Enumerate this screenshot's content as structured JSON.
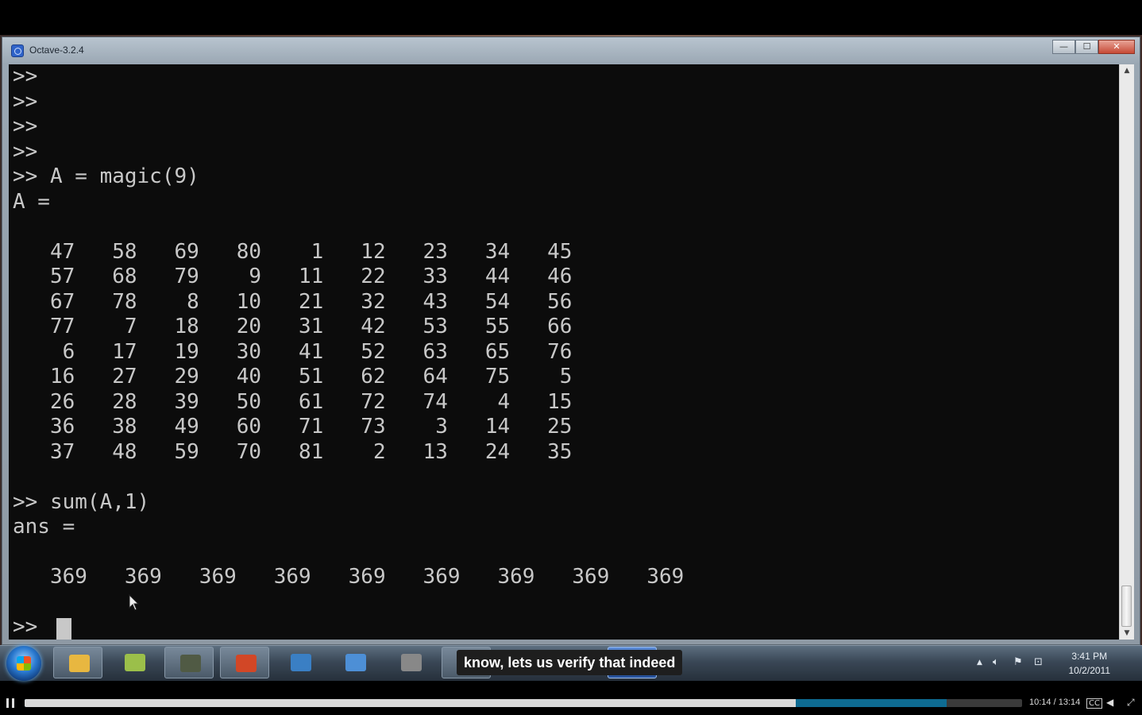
{
  "window": {
    "title": "Octave-3.2.4",
    "controls": {
      "minimize": "—",
      "maximize": "☐",
      "close": "✕"
    }
  },
  "console": {
    "lines": [
      ">>",
      ">>",
      ">>",
      ">>",
      ">> A = magic(9)",
      "A =",
      "",
      "   47   58   69   80    1   12   23   34   45",
      "   57   68   79    9   11   22   33   44   46",
      "   67   78    8   10   21   32   43   54   56",
      "   77    7   18   20   31   42   53   55   66",
      "    6   17   19   30   41   52   63   65   76",
      "   16   27   29   40   51   62   64   75    5",
      "   26   28   39   50   61   72   74    4   15",
      "   36   38   49   60   71   73    3   14   25",
      "   37   48   59   70   81    2   13   24   35",
      "",
      ">> sum(A,1)",
      "ans =",
      "",
      "   369   369   369   369   369   369   369   369   369",
      "",
      ">>"
    ]
  },
  "taskbar": {
    "pinned": [
      {
        "name": "explorer-icon",
        "color": "#e8b740"
      },
      {
        "name": "notes-icon",
        "color": "#9bbf4a"
      },
      {
        "name": "camcorder-icon",
        "color": "#505a44"
      },
      {
        "name": "powerpoint-icon",
        "color": "#d24726"
      },
      {
        "name": "network-icon",
        "color": "#3a7fc4"
      },
      {
        "name": "remote-desktop-icon",
        "color": "#4d8fd6"
      },
      {
        "name": "camera-icon",
        "color": "#888888"
      },
      {
        "name": "chrome-icon",
        "color": "#e0443e"
      },
      {
        "name": "octave-taskbar-icon",
        "color": "#2f63c9"
      }
    ],
    "clock": {
      "time": "3:41 PM",
      "date": "10/2/2011"
    }
  },
  "caption": "know, lets us verify that indeed",
  "player": {
    "time": "10:14 / 13:14",
    "played_fraction": 0.773,
    "buffered_fraction": 0.924
  }
}
